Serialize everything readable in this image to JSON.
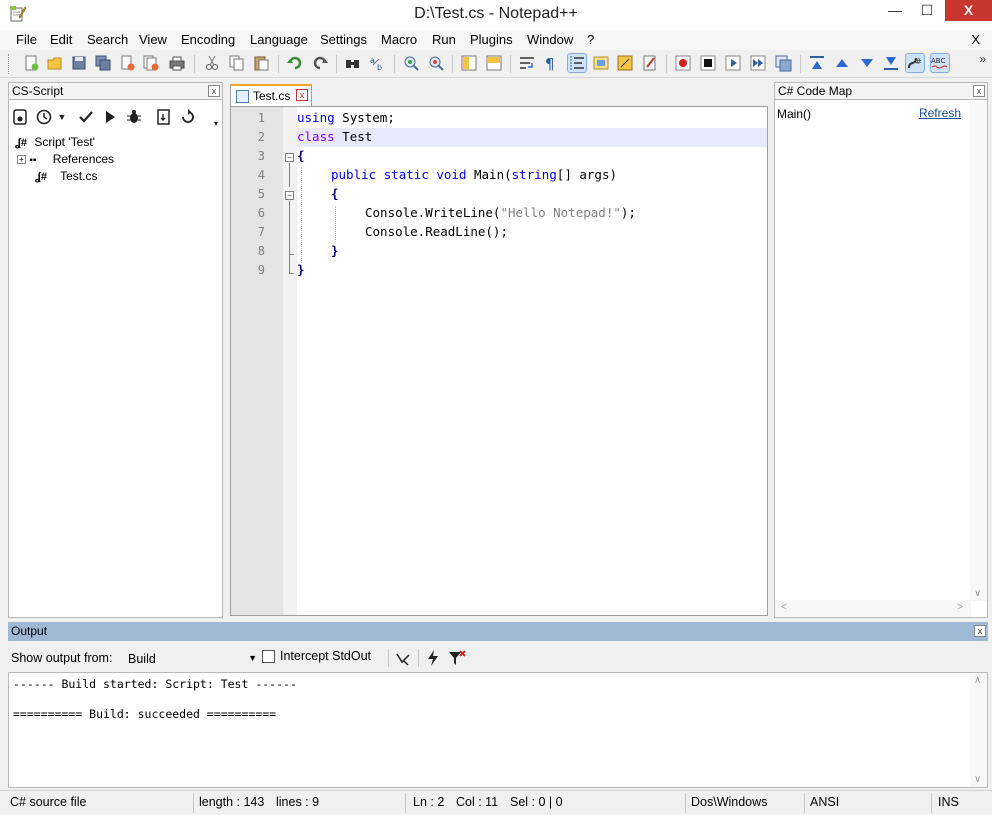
{
  "window": {
    "title": "D:\\Test.cs - Notepad++",
    "minimize": "—",
    "maximize": "☐",
    "close": "X"
  },
  "menu": {
    "items": [
      "File",
      "Edit",
      "Search",
      "View",
      "Encoding",
      "Language",
      "Settings",
      "Macro",
      "Run",
      "Plugins",
      "Window",
      "?"
    ],
    "close": "X"
  },
  "toolbar": {
    "icons": [
      "new-file-icon",
      "open-file-icon",
      "save-icon",
      "save-all-icon",
      "close-icon",
      "close-all-icon",
      "print-icon",
      "cut-icon",
      "copy-icon",
      "paste-icon",
      "undo-icon",
      "redo-icon",
      "find-icon",
      "replace-icon",
      "zoom-in-icon",
      "zoom-out-icon",
      "sync-vertical-icon",
      "sync-horizontal-icon",
      "word-wrap-icon",
      "show-all-chars-icon",
      "indent-guide-icon",
      "user-lang-icon",
      "doc-map-icon",
      "function-list-icon",
      "record-macro-icon",
      "stop-macro-icon",
      "play-macro-icon",
      "run-macro-multiple-icon",
      "save-macro-icon",
      "collapse-icon",
      "up-icon",
      "down-icon",
      "expand-icon",
      "cs-script-icon",
      "spellcheck-icon"
    ],
    "more": "»"
  },
  "left_panel": {
    "title": "CS-Script",
    "close": "x",
    "tree": {
      "root": "Script 'Test'",
      "references": "References",
      "file": "Test.cs",
      "expander": "+"
    }
  },
  "editor": {
    "tab": {
      "label": "Test.cs",
      "close": "x"
    },
    "line_numbers": [
      "1",
      "2",
      "3",
      "4",
      "5",
      "6",
      "7",
      "8",
      "9"
    ],
    "lines": {
      "l1_kw": "using",
      "l1_rest": " System;",
      "l2_kw": "class",
      "l2_rest": " Test",
      "l3": "{",
      "l4_kw1": "public",
      "l4_kw2": "static",
      "l4_kw3": "void",
      "l4_name": " Main(",
      "l4_kw4": "string",
      "l4_rest": "[] args)",
      "l5": "{",
      "l6_pre": "Console.WriteLine(",
      "l6_str": "\"Hello Notepad!\"",
      "l6_post": ");",
      "l7": "Console.ReadLine();",
      "l8": "}",
      "l9": "}"
    }
  },
  "right_panel": {
    "title": "C# Code Map",
    "close": "x",
    "item": "Main()",
    "refresh": "Refresh"
  },
  "output": {
    "title": "Output",
    "close": "x",
    "show_output_from": "Show output from:",
    "selected_source": "Build",
    "intercept_label": "Intercept StdOut",
    "lines": [
      "------ Build started: Script: Test ------",
      "========== Build: succeeded =========="
    ]
  },
  "status": {
    "file_type": "C# source file",
    "length": "length : 143",
    "lines": "lines : 9",
    "ln": "Ln : 2",
    "col": "Col : 11",
    "sel": "Sel : 0 | 0",
    "eol": "Dos\\Windows",
    "encoding": "ANSI",
    "mode": "INS"
  }
}
